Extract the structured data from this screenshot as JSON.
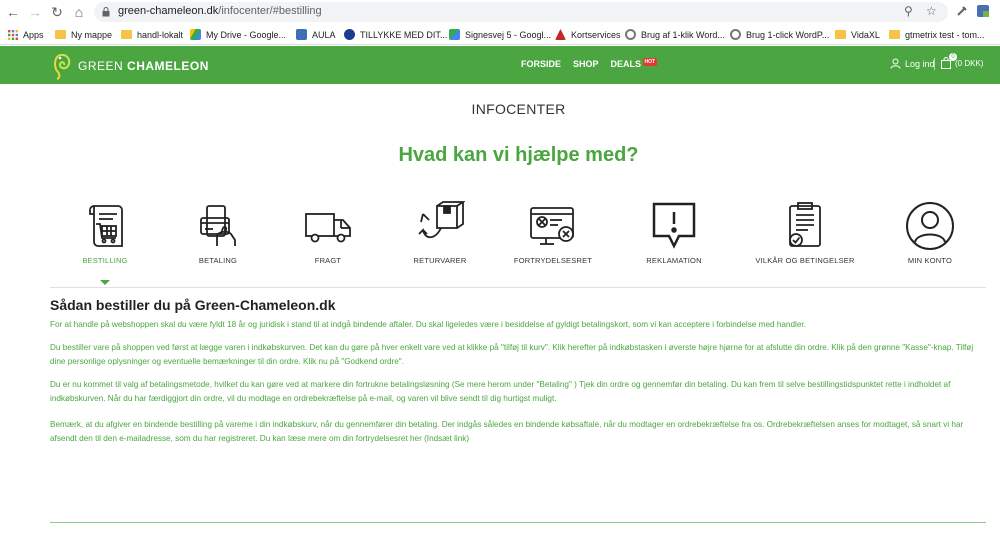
{
  "browser": {
    "url_domain": "green-chameleon.dk",
    "url_path": "/infocenter/#bestilling",
    "bookmarks": [
      {
        "label": "Apps",
        "icon": "apps-grid-icon"
      },
      {
        "label": "Ny mappe",
        "icon": "folder-icon"
      },
      {
        "label": "handl-lokalt",
        "icon": "folder-icon"
      },
      {
        "label": "My Drive - Google...",
        "icon": "google-drive-icon"
      },
      {
        "label": "AULA",
        "icon": "aula-icon"
      },
      {
        "label": "TILLYKKE MED DIT...",
        "icon": "site-icon"
      },
      {
        "label": "Signesvej 5 - Googl...",
        "icon": "google-maps-icon"
      },
      {
        "label": "Kortservices",
        "icon": "site-icon"
      },
      {
        "label": "Brug af 1-klik Word...",
        "icon": "site-icon"
      },
      {
        "label": "Brug 1-click WordP...",
        "icon": "site-icon"
      },
      {
        "label": "VidaXL",
        "icon": "folder-icon"
      },
      {
        "label": "gtmetrix test - tom...",
        "icon": "folder-icon"
      }
    ]
  },
  "header": {
    "logo_bold": "GREEN",
    "logo_rest": " CHAMELEON",
    "nav": [
      "FORSIDE",
      "SHOP",
      "DEALS"
    ],
    "hot_badge": "HOT",
    "login_label": "Log ind",
    "cart_label": "(0 DKK)",
    "cart_count": "0",
    "brand_color": "#4ba641"
  },
  "page": {
    "infocenter": "INFOCENTER",
    "help_title": "Hvad kan vi hjælpe med?",
    "categories": [
      {
        "label": "BESTILLING",
        "icon": "order-scroll-icon",
        "active": true
      },
      {
        "label": "BETALING",
        "icon": "payment-card-icon",
        "active": false
      },
      {
        "label": "FRAGT",
        "icon": "delivery-truck-icon",
        "active": false
      },
      {
        "label": "RETURVARER",
        "icon": "return-box-icon",
        "active": false
      },
      {
        "label": "FORTRYDELSESRET",
        "icon": "cancel-order-icon",
        "active": false
      },
      {
        "label": "REKLAMATION",
        "icon": "complaint-bubble-icon",
        "active": false
      },
      {
        "label": "VILKÅR OG BETINGELSER",
        "icon": "terms-clipboard-icon",
        "active": false
      },
      {
        "label": "MIN KONTO",
        "icon": "account-user-icon",
        "active": false
      }
    ],
    "section_title": "Sådan bestiller du på Green-Chameleon.dk",
    "paragraphs": [
      "For at handle på webshoppen skal du være fyldt 18 år og juridisk i stand til at indgå bindende aftaler. Du skal ligeledes være i besiddelse af gyldigt betalingskort, som vi kan acceptere i forbindelse med handler.",
      "Du bestiller vare på shoppen ved først at lægge varen i indkøbskurven. Det kan du gøre på hver enkelt vare ved at klikke på \"tilføj til kurv\". Klik herefter på indkøbstasken i øverste højre hjørne for at afslutte din ordre. Klik på den grønne \"Kasse\"-knap. Tilføj dine personlige oplysninger og eventuelle bemærkninger til din ordre. Klik nu på \"Godkend ordre\".",
      "Du er nu kommet til valg af betalingsmetode, hvilket du kan gøre ved at markere din fortrukne betalingsløsning (Se mere herom under \"Betaling\" ) Tjek din ordre og gennemfør din betaling. Du kan frem til selve bestillingstidspunktet rette i indholdet af indkøbskurven. Når du har færdiggjort din ordre, vil du modtage en ordrebekræftelse på e-mail, og varen vil blive sendt til dig hurtigst muligt.",
      "Bemærk, at du afgiver en bindende bestilling på vareme i din indkøbskurv, når du gennemfører din betaling. Der indgås således en bindende købsaftale, når du modtager en ordrebekræftelse fra os. Ordrebekræftelsen anses for modtaget, så snart vi har afsendt den til den e-mailadresse, som du har registreret. Du kan læse mere om din fortrydelsesret her (Indsæt link)"
    ]
  }
}
